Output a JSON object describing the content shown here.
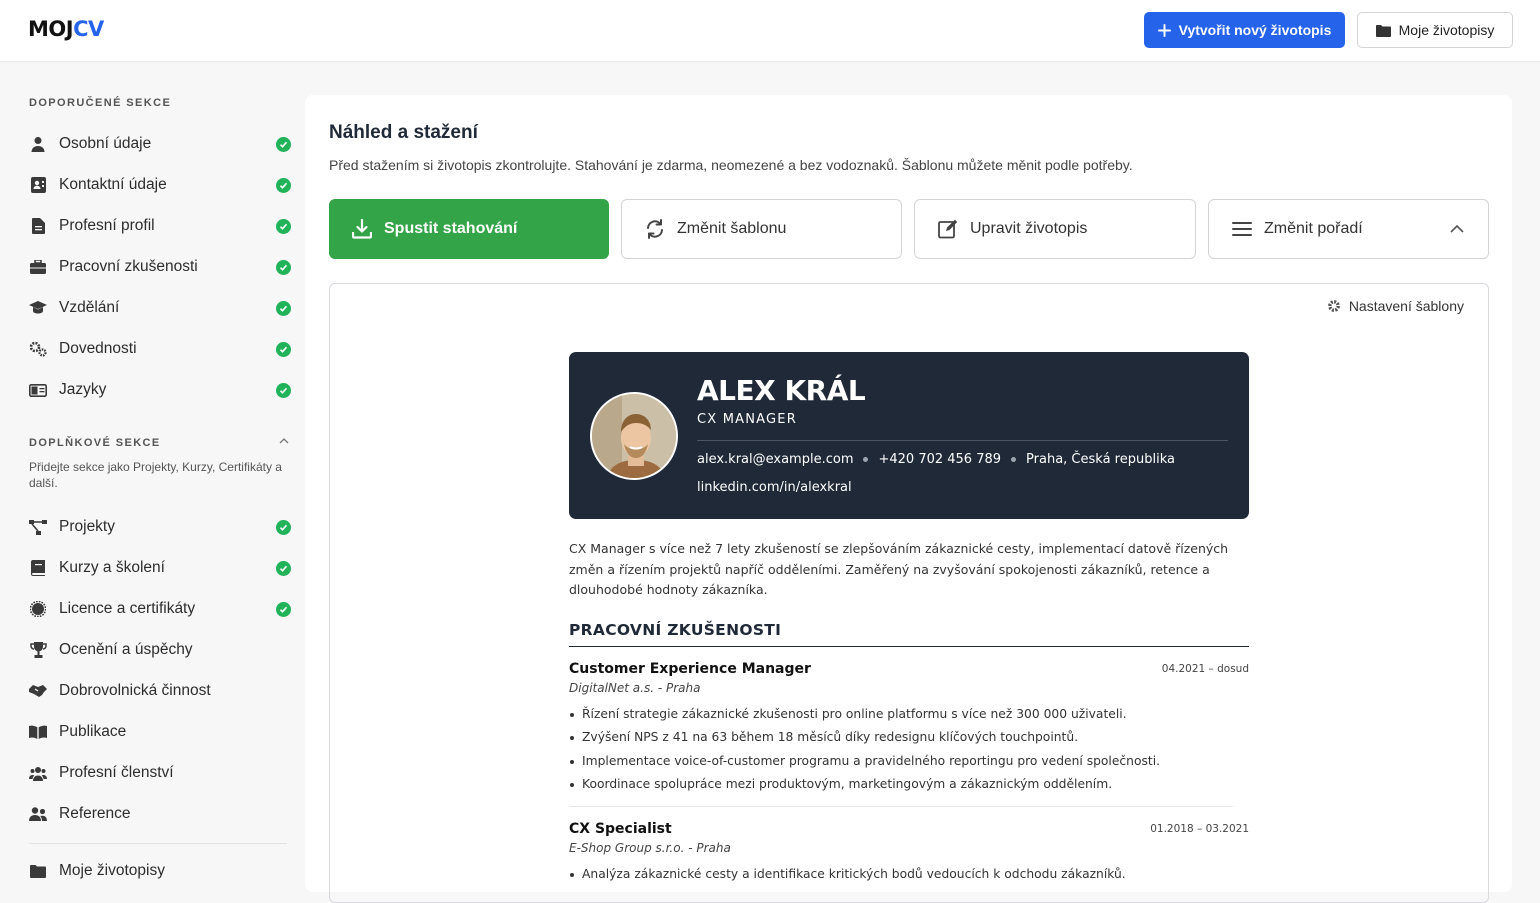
{
  "app": {
    "logo_part1": "MOJ",
    "logo_part2": "CV"
  },
  "header": {
    "new_cv_label": "Vytvořit nový životopis",
    "my_cvs_label": "Moje životopisy"
  },
  "sidebar": {
    "recommended_title": "DOPORUČENÉ SEKCE",
    "recommended": [
      {
        "label": "Osobní údaje",
        "icon": "user-icon",
        "done": true
      },
      {
        "label": "Kontaktní údaje",
        "icon": "contact-card-icon",
        "done": true
      },
      {
        "label": "Profesní profil",
        "icon": "document-icon",
        "done": true
      },
      {
        "label": "Pracovní zkušenosti",
        "icon": "briefcase-icon",
        "done": true
      },
      {
        "label": "Vzdělání",
        "icon": "graduation-cap-icon",
        "done": true
      },
      {
        "label": "Dovednosti",
        "icon": "gears-icon",
        "done": true
      },
      {
        "label": "Jazyky",
        "icon": "language-icon",
        "done": true
      }
    ],
    "additional_title": "DOPLŇKOVÉ SEKCE",
    "additional_note": "Přidejte sekce jako Projekty, Kurzy, Certifikáty a další.",
    "additional": [
      {
        "label": "Projekty",
        "icon": "project-diagram-icon",
        "done": true
      },
      {
        "label": "Kurzy a školení",
        "icon": "book-icon",
        "done": true
      },
      {
        "label": "Licence a certifikáty",
        "icon": "certificate-icon",
        "done": true
      },
      {
        "label": "Ocenění a úspěchy",
        "icon": "trophy-icon",
        "done": false
      },
      {
        "label": "Dobrovolnická činnost",
        "icon": "handshake-icon",
        "done": false
      },
      {
        "label": "Publikace",
        "icon": "open-book-icon",
        "done": false
      },
      {
        "label": "Profesní členství",
        "icon": "users-icon",
        "done": false
      },
      {
        "label": "Reference",
        "icon": "user-friends-icon",
        "done": false
      }
    ],
    "my_cvs": "Moje životopisy"
  },
  "main": {
    "title": "Náhled a stažení",
    "description": "Před stažením si životopis zkontrolujte. Stahování je zdarma, neomezené a bez vodoznaků. Šablonu můžete měnit podle potřeby.",
    "actions": {
      "download": "Spustit stahování",
      "change_template": "Změnit šablonu",
      "edit": "Upravit životopis",
      "reorder": "Změnit pořadí"
    },
    "template_settings": "Nastavení šablony"
  },
  "cv": {
    "name": "ALEX KRÁL",
    "role": "CX MANAGER",
    "email": "alex.kral@example.com",
    "phone": "+420 702 456 789",
    "location": "Praha, Česká republika",
    "linkedin": "linkedin.com/in/alexkral",
    "summary": "CX Manager s více než 7 lety zkušeností se zlepšováním zákaznické cesty, implementací datově řízených změn a řízením projektů napříč odděleními. Zaměřený na zvyšování spokojenosti zákazníků, retence a dlouhodobé hodnoty zákazníka.",
    "section_experience": "PRACOVNÍ ZKUŠENOSTI",
    "jobs": [
      {
        "title": "Customer Experience Manager",
        "date": "04.2021 – dosud",
        "company": "DigitalNet a.s. - Praha",
        "bullets": [
          "Řízení strategie zákaznické zkušenosti pro online platformu s více než 300 000 uživateli.",
          "Zvýšení NPS z 41 na 63 během 18 měsíců díky redesignu klíčových touchpointů.",
          "Implementace voice-of-customer programu a pravidelného reportingu pro vedení společnosti.",
          "Koordinace spolupráce mezi produktovým, marketingovým a zákaznickým oddělením."
        ]
      },
      {
        "title": "CX Specialist",
        "date": "01.2018 – 03.2021",
        "company": "E-Shop Group s.r.o. - Praha",
        "bullets": [
          "Analýza zákaznické cesty a identifikace kritických bodů vedoucích k odchodu zákazníků."
        ]
      }
    ]
  },
  "colors": {
    "primary": "#2563eb",
    "download": "#34a448",
    "check": "#22b35a",
    "cv_header": "#1f2937"
  }
}
